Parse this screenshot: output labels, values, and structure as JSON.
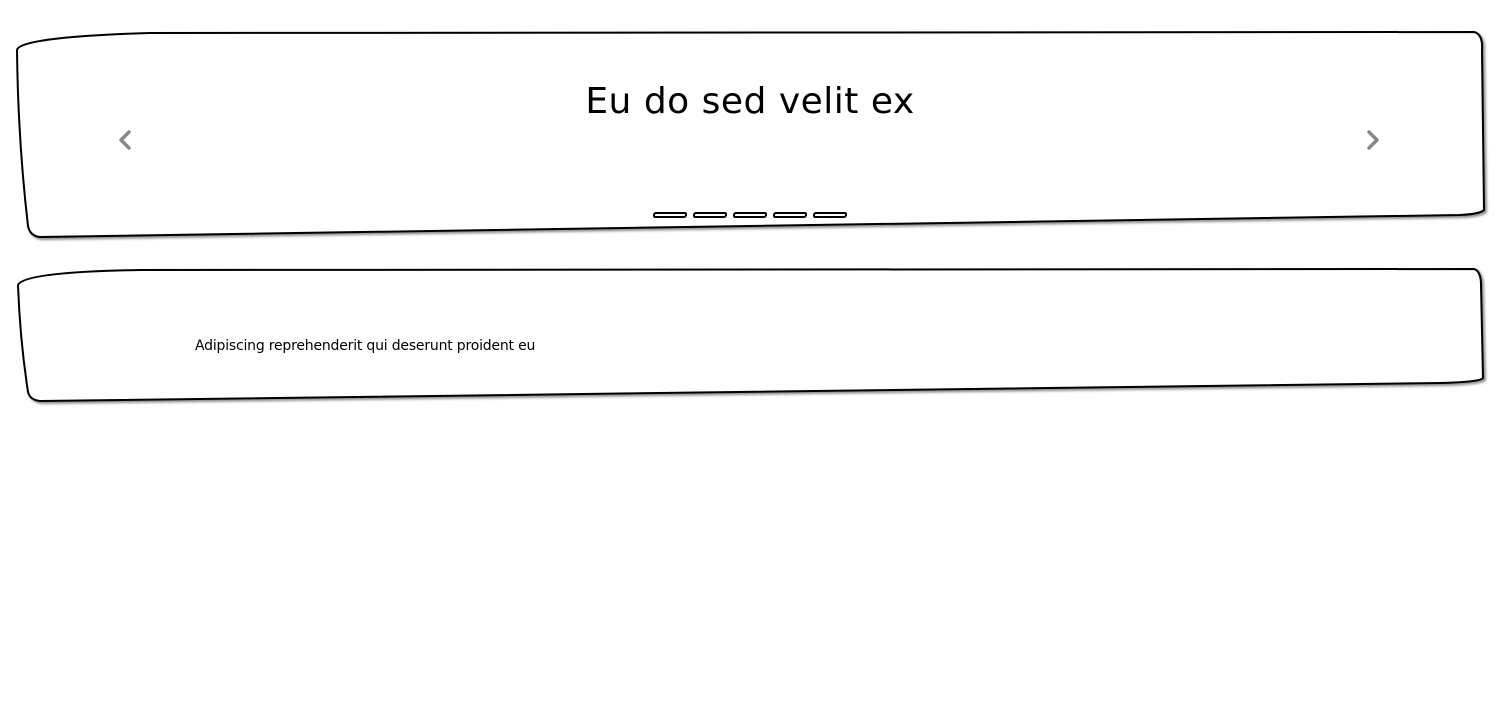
{
  "carousel": {
    "slide_title": "Eu do sed velit ex",
    "prev_icon": "chevron-left-icon",
    "next_icon": "chevron-right-icon",
    "indicator_count": 5,
    "arrow_color": "#888888"
  },
  "card": {
    "text": "Adipiscing reprehenderit qui deserunt proident eu"
  }
}
